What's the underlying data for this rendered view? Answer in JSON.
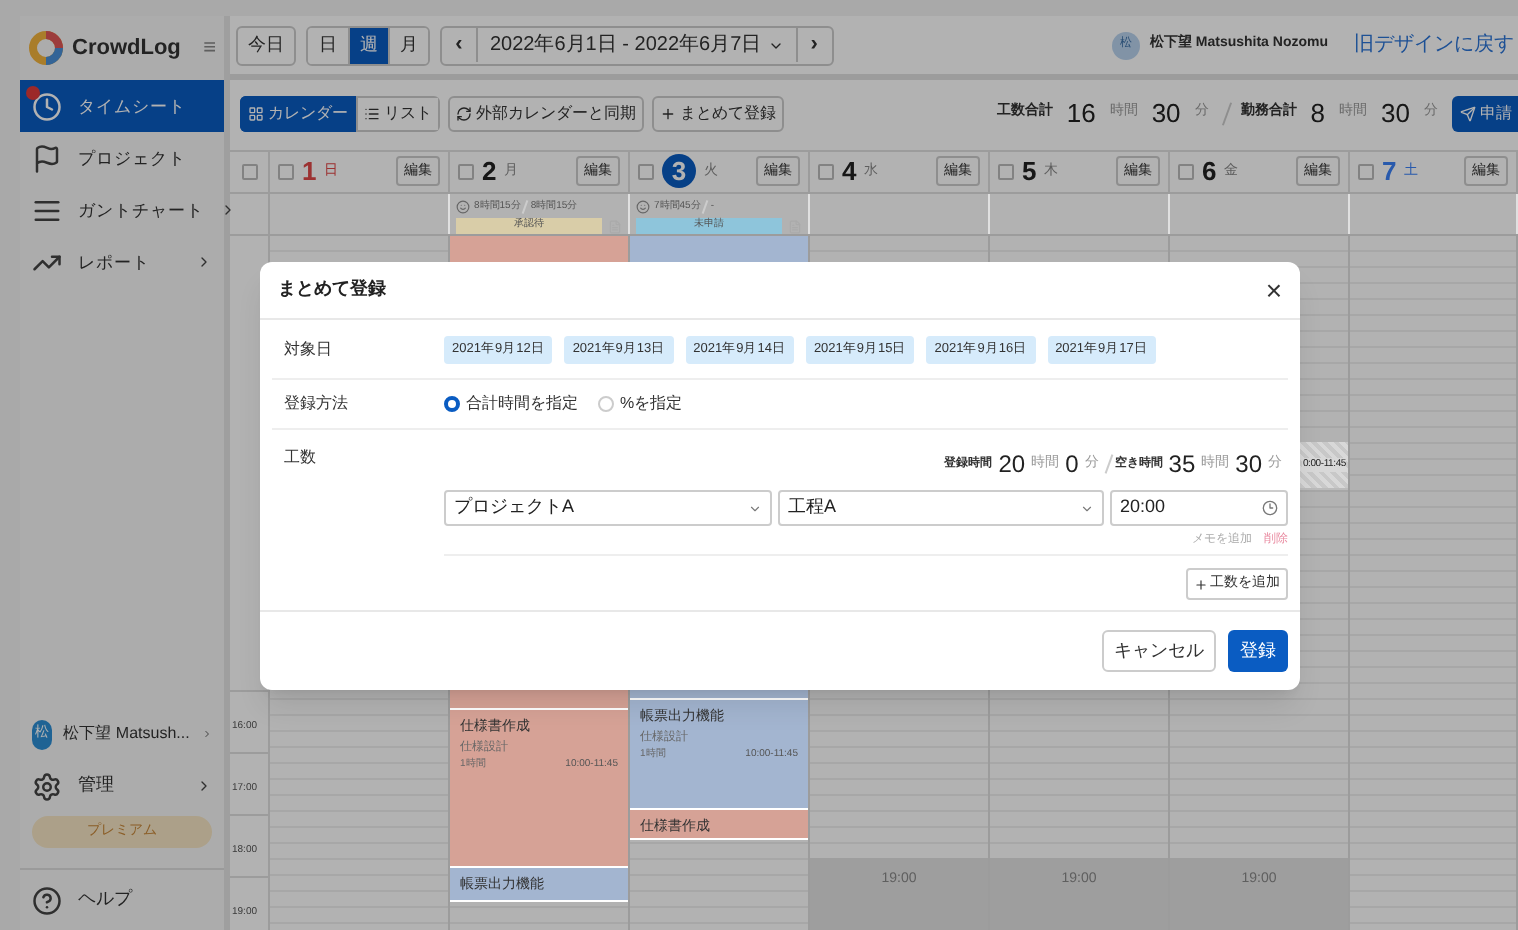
{
  "sidebar": {
    "logo": "CrowdLog",
    "menu_icon": "≡",
    "items": [
      {
        "label": "タイムシート",
        "selected": true,
        "badge": true,
        "submenu": false
      },
      {
        "label": "プロジェクト",
        "selected": false,
        "badge": false,
        "submenu": false
      },
      {
        "label": "ガントチャート",
        "selected": false,
        "badge": false,
        "submenu": true
      },
      {
        "label": "レポート",
        "selected": false,
        "badge": false,
        "submenu": true
      }
    ],
    "user": {
      "avatar": "松",
      "name": "松下望 Matsush...",
      "submenu": true
    },
    "admin": {
      "label": "管理",
      "submenu": true
    },
    "premium": "プレミアム",
    "help": "ヘルプ"
  },
  "topbar": {
    "today": "今日",
    "views": [
      {
        "label": "日",
        "selected": false
      },
      {
        "label": "週",
        "selected": true
      },
      {
        "label": "月",
        "selected": false
      }
    ],
    "prev": "‹",
    "range": "2022年6月1日 - 2022年6月7日",
    "next": "›",
    "user_avatar": "松",
    "user_name": "松下望 Matsushita Nozomu",
    "old_design": "旧デザインに戻す"
  },
  "toolbar": {
    "modes": [
      {
        "label": "カレンダー",
        "selected": true
      },
      {
        "label": "リスト",
        "selected": false
      }
    ],
    "sync": "外部カレンダーと同期",
    "bulk": "まとめて登録",
    "work_label": "工数合計",
    "work_h": "16",
    "work_h_unit": "時間",
    "work_m": "30",
    "work_m_unit": "分",
    "duty_label": "勤務合計",
    "duty_h": "8",
    "duty_h_unit": "時間",
    "duty_m": "30",
    "duty_m_unit": "分",
    "apply": "申請"
  },
  "all_checked": false,
  "days": [
    {
      "number": "1",
      "weekday": "日",
      "kind": "sunday",
      "checked": false,
      "edit": "編集"
    },
    {
      "number": "2",
      "weekday": "月",
      "kind": "weekday",
      "checked": false,
      "edit": "編集",
      "hours": "8時間15分",
      "duty": "8時間15分",
      "status": "承認待",
      "color": "#d9cda8",
      "events": [
        {
          "kind": "task",
          "color": "#d6a296"
        },
        {
          "kind": "task",
          "color": "#d6a296",
          "title": "仕様書作成",
          "sub": "仕様設計",
          "dur": "1時間",
          "time": "10:00-11:45"
        },
        {
          "kind": "task",
          "color": "#a3b5d0",
          "title": "帳票出力機能"
        }
      ]
    },
    {
      "number": "3",
      "weekday": "火",
      "kind": "today",
      "checked": false,
      "edit": "編集",
      "hours": "7時間45分",
      "duty": "-",
      "status": "未申請",
      "color": "#8ec5db",
      "events": [
        {
          "kind": "task",
          "color": "#a3b5d0"
        },
        {
          "kind": "task",
          "color": "#a3b5d0",
          "title": "帳票出力機能",
          "sub": "仕様設計",
          "dur": "1時間",
          "time": "10:00-11:45"
        },
        {
          "kind": "task",
          "color": "#d6a296",
          "title": "仕様書作成"
        }
      ]
    },
    {
      "number": "4",
      "weekday": "水",
      "kind": "weekday",
      "checked": false,
      "edit": "編集",
      "offhours": "19:00"
    },
    {
      "number": "5",
      "weekday": "木",
      "kind": "weekday",
      "checked": false,
      "edit": "編集",
      "offhours": "19:00"
    },
    {
      "number": "6",
      "weekday": "金",
      "kind": "weekday",
      "checked": false,
      "edit": "編集",
      "offhours": "19:00",
      "events": [
        {
          "kind": "hatched",
          "time": "0:00-11:45"
        }
      ]
    },
    {
      "number": "7",
      "weekday": "土",
      "kind": "saturday",
      "checked": false,
      "edit": "編集"
    }
  ],
  "hours": [
    "16:00",
    "17:00",
    "18:00",
    "19:00"
  ],
  "modal": {
    "title": "まとめて登録",
    "close": "×",
    "dates_label": "対象日",
    "dates": [
      "2021年9月12日",
      "2021年9月13日",
      "2021年9月14日",
      "2021年9月15日",
      "2021年9月16日",
      "2021年9月17日"
    ],
    "method_label": "登録方法",
    "methods": [
      {
        "label": "合計時間を指定",
        "selected": true
      },
      {
        "label": "%を指定",
        "selected": false
      }
    ],
    "work_label": "工数",
    "reg_label": "登録時間",
    "reg_h": "20",
    "reg_h_unit": "時間",
    "reg_m": "0",
    "reg_m_unit": "分",
    "free_label": "空き時間",
    "free_h": "35",
    "free_h_unit": "時間",
    "free_m": "30",
    "free_m_unit": "分",
    "entry": {
      "project": "プロジェクトA",
      "process": "工程A",
      "time": "20:00",
      "add_memo": "メモを追加",
      "delete": "削除"
    },
    "add_work": "工数を追加",
    "cancel": "キャンセル",
    "submit": "登録"
  }
}
